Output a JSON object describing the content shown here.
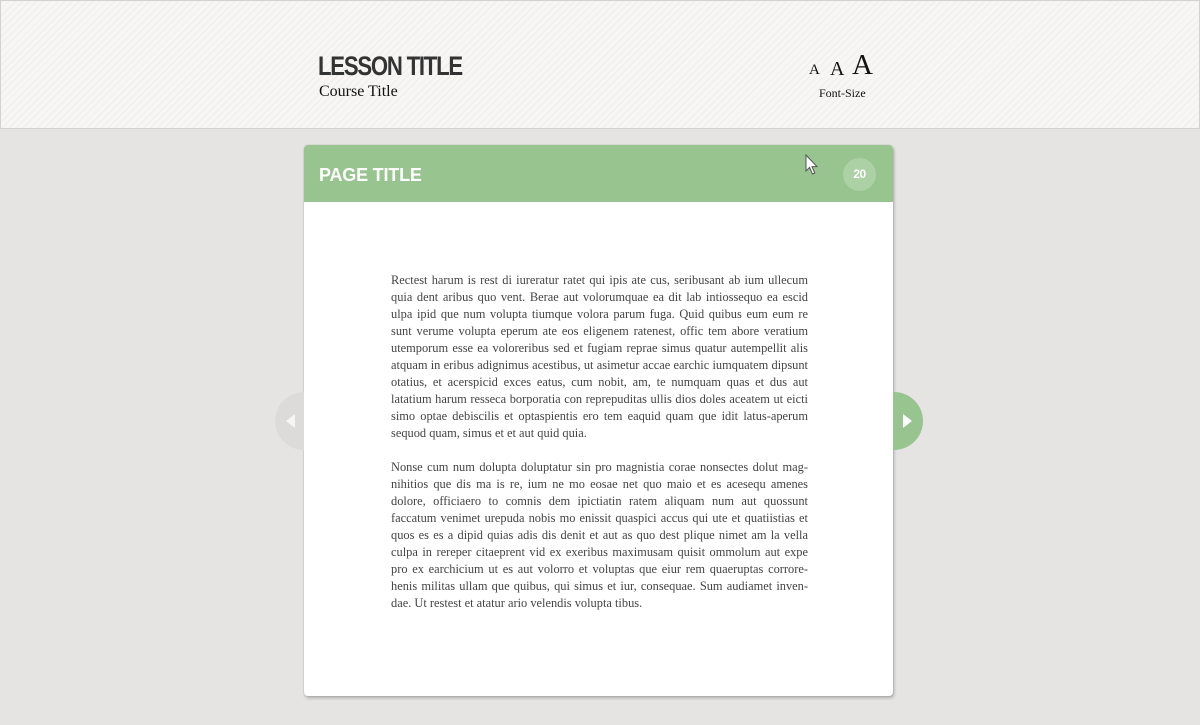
{
  "header": {
    "lesson_title": "LESSON TITLE",
    "course_title": "Course Title",
    "font_size": {
      "small_label": "A",
      "medium_label": "A",
      "large_label": "A",
      "caption": "Font-Size"
    }
  },
  "page": {
    "title": "PAGE TITLE",
    "page_number": "20",
    "paragraphs": [
      "Rectest harum is rest di iureratur ratet qui ipis ate cus, seribusant ab ium ullecum quia dent aribus quo vent. Berae aut volorumquae ea dit lab intiossequo ea escid ulpa ipid que num volupta tiumque volora parum fuga. Quid quibus eum eum re sunt verume volupta eperum ate eos eligenem ratenest, offic tem abore veratium utemporum esse ea voloreribus sed et fugiam reprae simus quatur autempellit alis atquam in eribus adignimus acestibus, ut asimetur accae earchic iumquatem dipsunt otatius, et acerspicid exces eatus, cum nobit, am, te numquam quas et dus aut latatium harum resseca borporatia con reprepuditas ullis dios doles aceatem ut eicti simo optae debiscilis et optaspientis ero tem eaquid quam que idit latus-aperum sequod quam, simus et et aut quid quia.",
      "Nonse cum num dolupta doluptatur sin pro magnistia corae nonsectes dolut mag-nihitios que dis ma is re, ium ne mo eosae net quo maio et es acesequ amenes dolore, officiaero to comnis dem ipictiatin ratem aliquam num aut quossunt faccatum venimet urepuda nobis mo enissit quaspici accus qui ute et quatiistias et quos es es a dipid quias adis dis denit et aut as quo dest plique nimet am la vella culpa in rereper citaeprent vid ex exeribus maximusam quisit ommolum aut expe pro ex earchicium ut es aut volorro et voluptas que eiur rem quaeruptas corrore-henis militas ullam que quibus, qui simus et iur, consequae. Sum audiamet inven-dae. Ut restest et atatur ario velendis volupta tibus."
    ]
  },
  "navigation": {
    "prev_icon": "arrow-left-icon",
    "next_icon": "arrow-right-icon"
  },
  "colors": {
    "accent_green": "#98c48f",
    "badge_green": "#acd1a4",
    "background": "#e6e4e3",
    "nav_disabled": "#dcdbda"
  }
}
